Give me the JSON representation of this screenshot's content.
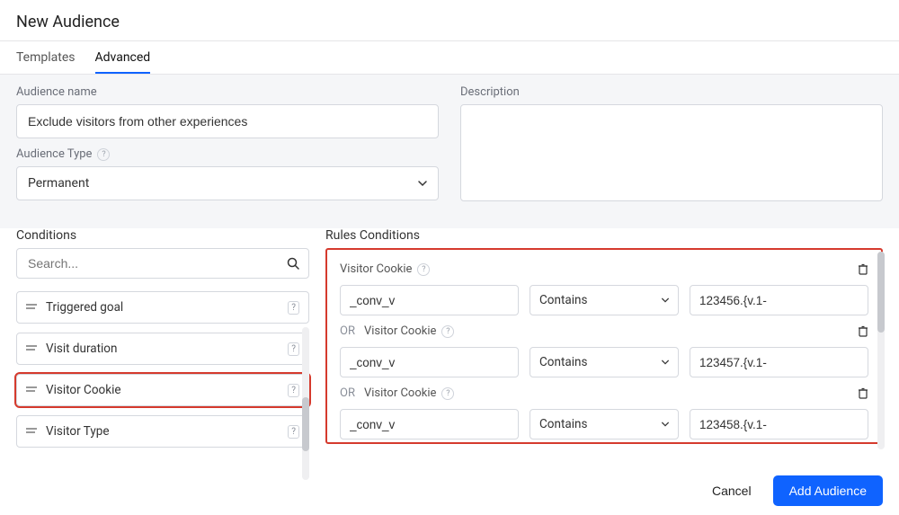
{
  "header": {
    "title": "New Audience"
  },
  "tabs": {
    "templates": "Templates",
    "advanced": "Advanced",
    "active": "advanced"
  },
  "form": {
    "name_label": "Audience name",
    "name_value": "Exclude visitors from other experiences",
    "type_label": "Audience Type",
    "type_value": "Permanent",
    "description_label": "Description",
    "description_value": ""
  },
  "conditions": {
    "title": "Conditions",
    "search_placeholder": "Search...",
    "items": [
      {
        "label": "Triggered goal",
        "highlight": false
      },
      {
        "label": "Visit duration",
        "highlight": false
      },
      {
        "label": "Visitor Cookie",
        "highlight": true
      },
      {
        "label": "Visitor Type",
        "highlight": false
      }
    ]
  },
  "rules": {
    "title": "Rules Conditions",
    "group_label": "Visitor Cookie",
    "or_prefix": "OR",
    "rows": [
      {
        "cookie": "_conv_v",
        "op": "Contains",
        "value": "123456.{v.1-"
      },
      {
        "cookie": "_conv_v",
        "op": "Contains",
        "value": "123457.{v.1-"
      },
      {
        "cookie": "_conv_v",
        "op": "Contains",
        "value": "123458.{v.1-"
      }
    ]
  },
  "footer": {
    "cancel": "Cancel",
    "submit": "Add Audience"
  }
}
